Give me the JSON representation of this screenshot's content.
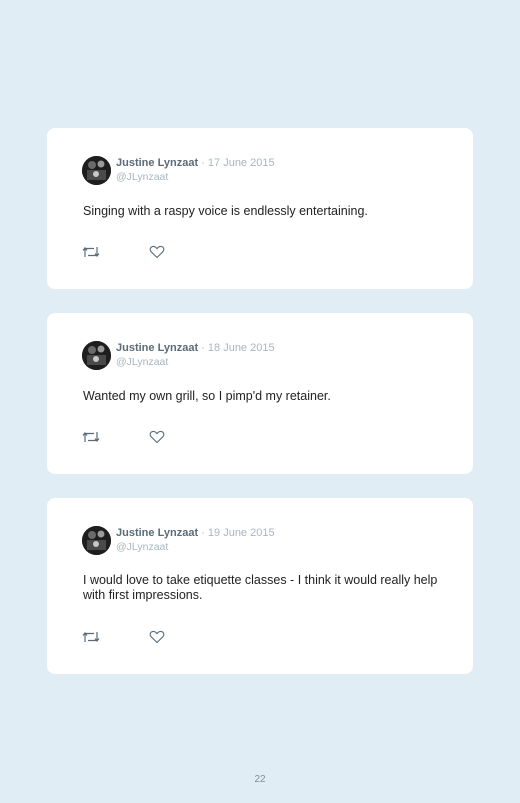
{
  "tweets": [
    {
      "author": "Justine Lynzaat",
      "separator": " · ",
      "date": "17 June 2015",
      "handle": "@JLynzaat",
      "text": "Singing with a raspy voice is endlessly entertaining."
    },
    {
      "author": "Justine Lynzaat",
      "separator": " · ",
      "date": "18 June 2015",
      "handle": "@JLynzaat",
      "text": "Wanted my own grill, so I pimp'd my retainer."
    },
    {
      "author": "Justine Lynzaat",
      "separator": " · ",
      "date": "19 June 2015",
      "handle": "@JLynzaat",
      "text": "I would love to take etiquette classes - I think it would really help with first impressions."
    }
  ],
  "icons": {
    "retweet": "retweet-icon",
    "like": "heart-icon"
  },
  "colors": {
    "background": "#e0edf5",
    "card": "#ffffff",
    "author": "#5b6b78",
    "meta": "#a7b6c1",
    "text": "#222222",
    "icon": "#5b6b78"
  },
  "page_number": "22"
}
